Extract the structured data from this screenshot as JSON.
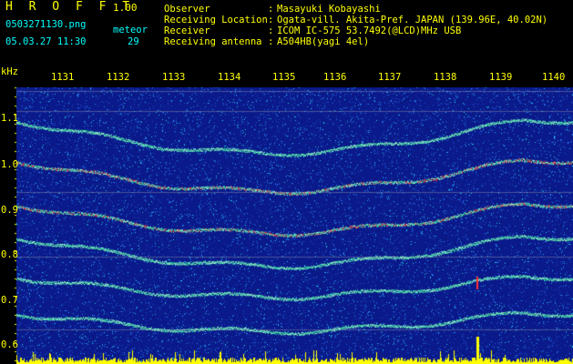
{
  "header": {
    "title": "H R O F F T",
    "version": "1.00",
    "filename": "0503271130.png",
    "meteor_label": "meteor",
    "datetime": "05.03.27 11:30",
    "meteor_count": "29"
  },
  "info": [
    {
      "key": "Observer",
      "value": "Masayuki Kobayashi"
    },
    {
      "key": "Receiving Location",
      "value": "Ogata-vill. Akita-Pref. JAPAN (139.96E, 40.02N)"
    },
    {
      "key": "Receiver",
      "value": "ICOM IC-575 53.7492(@LCD)MHz USB"
    },
    {
      "key": "Receiving antenna",
      "value": "A504HB(yagi 4el)"
    }
  ],
  "plot": {
    "y_unit": "kHz",
    "y_labels": [
      "1.1",
      "1.0",
      "0.9",
      "0.8",
      "0.7",
      "0.6"
    ],
    "x_labels": [
      "1131",
      "1132",
      "1133",
      "1134",
      "1135",
      "1136",
      "1137",
      "1138",
      "1139",
      "1140"
    ]
  },
  "colors": {
    "label": "#ffff00",
    "meta": "#00ffff",
    "background": "#000000",
    "noise_floor": "#0a1a8a",
    "trace": "#3ce0a0",
    "trace_hot": "#ff3030",
    "activity": "#ffff00"
  }
}
